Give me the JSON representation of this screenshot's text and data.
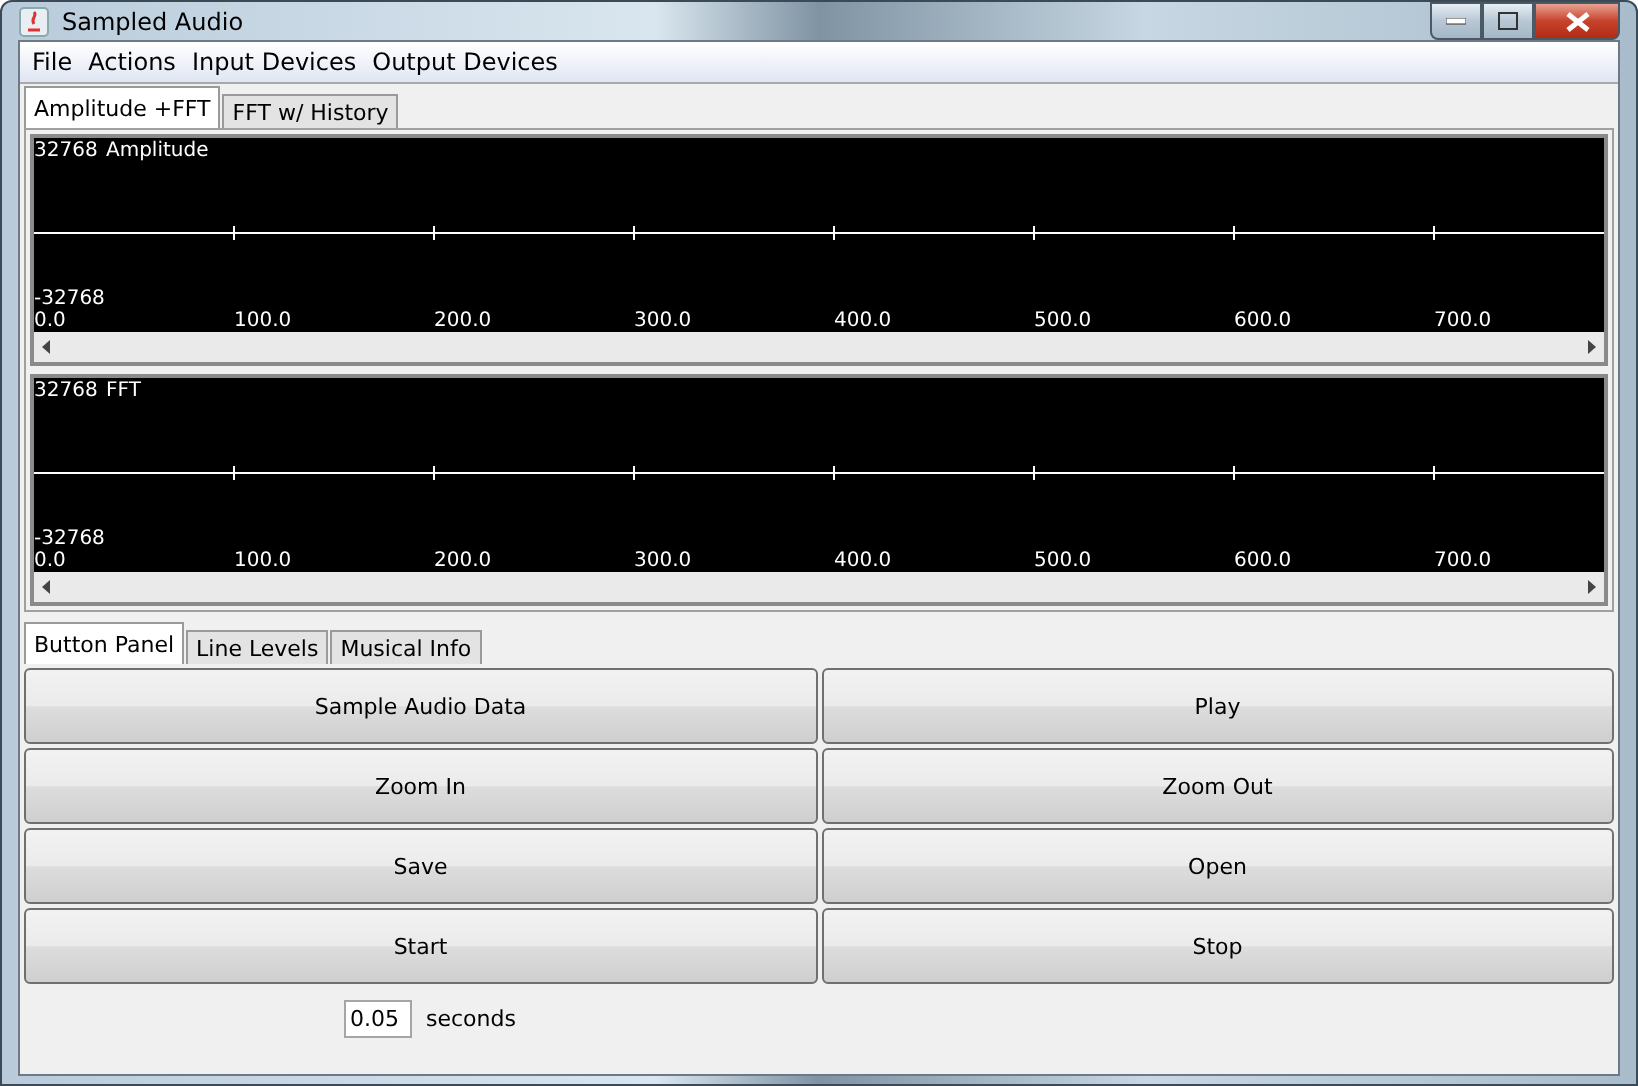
{
  "window": {
    "title": "Sampled Audio"
  },
  "menu": [
    "File",
    "Actions",
    "Input Devices",
    "Output Devices"
  ],
  "tabs": [
    {
      "label": "Amplitude +FFT",
      "selected": true
    },
    {
      "label": "FFT w/ History",
      "selected": false
    }
  ],
  "plots": [
    {
      "y_max": "32768",
      "title": "Amplitude",
      "y_min": "-32768",
      "x_labels": [
        "0.0",
        "100.0",
        "200.0",
        "300.0",
        "400.0",
        "500.0",
        "600.0",
        "700.0"
      ]
    },
    {
      "y_max": "32768",
      "title": "FFT",
      "y_min": "-32768",
      "x_labels": [
        "0.0",
        "100.0",
        "200.0",
        "300.0",
        "400.0",
        "500.0",
        "600.0",
        "700.0"
      ]
    }
  ],
  "panel_tabs": [
    {
      "label": "Button Panel",
      "selected": true
    },
    {
      "label": "Line Levels",
      "selected": false
    },
    {
      "label": "Musical Info",
      "selected": false
    }
  ],
  "buttons": [
    "Sample Audio Data",
    "Play",
    "Zoom In",
    "Zoom Out",
    "Save",
    "Open",
    "Start",
    "Stop"
  ],
  "duration": {
    "value": "0.05",
    "unit": "seconds"
  }
}
